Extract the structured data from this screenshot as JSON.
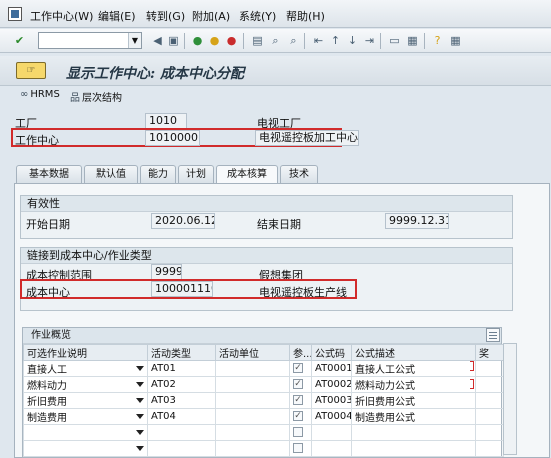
{
  "menu": {
    "items": [
      "工作中心(W)",
      "编辑(E)",
      "转到(G)",
      "附加(A)",
      "系统(Y)",
      "帮助(H)"
    ]
  },
  "title": "显示工作中心: 成本中心分配",
  "apptoolbar": {
    "hrms": "HRMS",
    "hierarchy": "层次结构"
  },
  "header": {
    "plant_label": "工厂",
    "plant_value": "1010",
    "plant_desc": "电视工厂",
    "wc_label": "工作中心",
    "wc_value": "10100001",
    "wc_desc": "电视遥控板加工中心"
  },
  "tabs": [
    "基本数据",
    "默认值",
    "能力",
    "计划",
    "成本核算",
    "技术"
  ],
  "validity": {
    "title": "有效性",
    "start_label": "开始日期",
    "start_value": "2020.06.12",
    "end_label": "结束日期",
    "end_value": "9999.12.31"
  },
  "link": {
    "title": "链接到成本中心/作业类型",
    "cca_label": "成本控制范围",
    "cca_value": "9999",
    "cca_desc": "假想集团",
    "cc_label": "成本中心",
    "cc_value": "1000011101",
    "cc_desc": "电视遥控板生产线"
  },
  "activities": {
    "caption": "作业概览",
    "columns": [
      "可选作业说明",
      "活动类型",
      "活动单位",
      "参...",
      "公式码",
      "公式描述",
      "奖"
    ],
    "rows": [
      {
        "desc": "直接人工",
        "type": "AT01",
        "unit": "",
        "checked": true,
        "code": "AT0001",
        "formula": "直接人工公式"
      },
      {
        "desc": "燃料动力",
        "type": "AT02",
        "unit": "",
        "checked": true,
        "code": "AT0002",
        "formula": "燃料动力公式"
      },
      {
        "desc": "折旧费用",
        "type": "AT03",
        "unit": "",
        "checked": true,
        "code": "AT0003",
        "formula": "折旧费用公式"
      },
      {
        "desc": "制造费用",
        "type": "AT04",
        "unit": "",
        "checked": true,
        "code": "AT0004",
        "formula": "制造费用公式"
      },
      {
        "desc": "",
        "type": "",
        "unit": "",
        "checked": false,
        "code": "",
        "formula": ""
      },
      {
        "desc": "",
        "type": "",
        "unit": "",
        "checked": false,
        "code": "",
        "formula": ""
      }
    ]
  },
  "colors": {
    "accent": "#d12b2b",
    "background": "#dfe7ee"
  },
  "icons": [
    "check-icon",
    "back-icon",
    "save-icon",
    "exit-icon",
    "cancel-icon",
    "print-icon",
    "find-icon",
    "first-page-icon",
    "last-page-icon",
    "layout-icon",
    "help-icon",
    "settings-icon"
  ]
}
